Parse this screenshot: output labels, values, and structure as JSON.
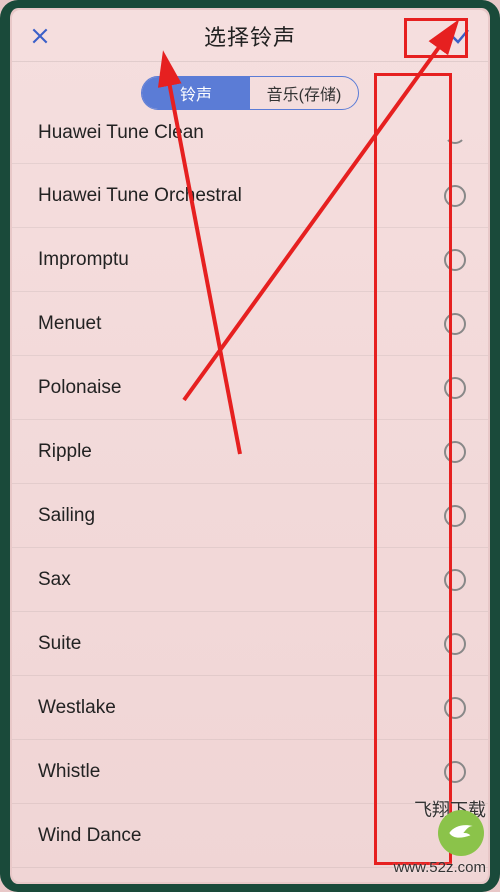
{
  "header": {
    "title": "选择铃声"
  },
  "tabs": {
    "ringtone": "铃声",
    "music": "音乐(存储)"
  },
  "list": [
    {
      "label": "Huawei Tune Clean",
      "selected": false,
      "partial": true
    },
    {
      "label": "Huawei Tune Orchestral",
      "selected": false
    },
    {
      "label": "Impromptu",
      "selected": false
    },
    {
      "label": "Menuet",
      "selected": false
    },
    {
      "label": "Polonaise",
      "selected": false
    },
    {
      "label": "Ripple",
      "selected": false
    },
    {
      "label": "Sailing",
      "selected": false
    },
    {
      "label": "Sax",
      "selected": false
    },
    {
      "label": "Suite",
      "selected": false
    },
    {
      "label": "Westlake",
      "selected": false
    },
    {
      "label": "Whistle",
      "selected": false
    },
    {
      "label": "Wind Dance",
      "selected": true
    }
  ],
  "watermark": {
    "brand": "飞翔下载",
    "url": "www.52z.com"
  }
}
